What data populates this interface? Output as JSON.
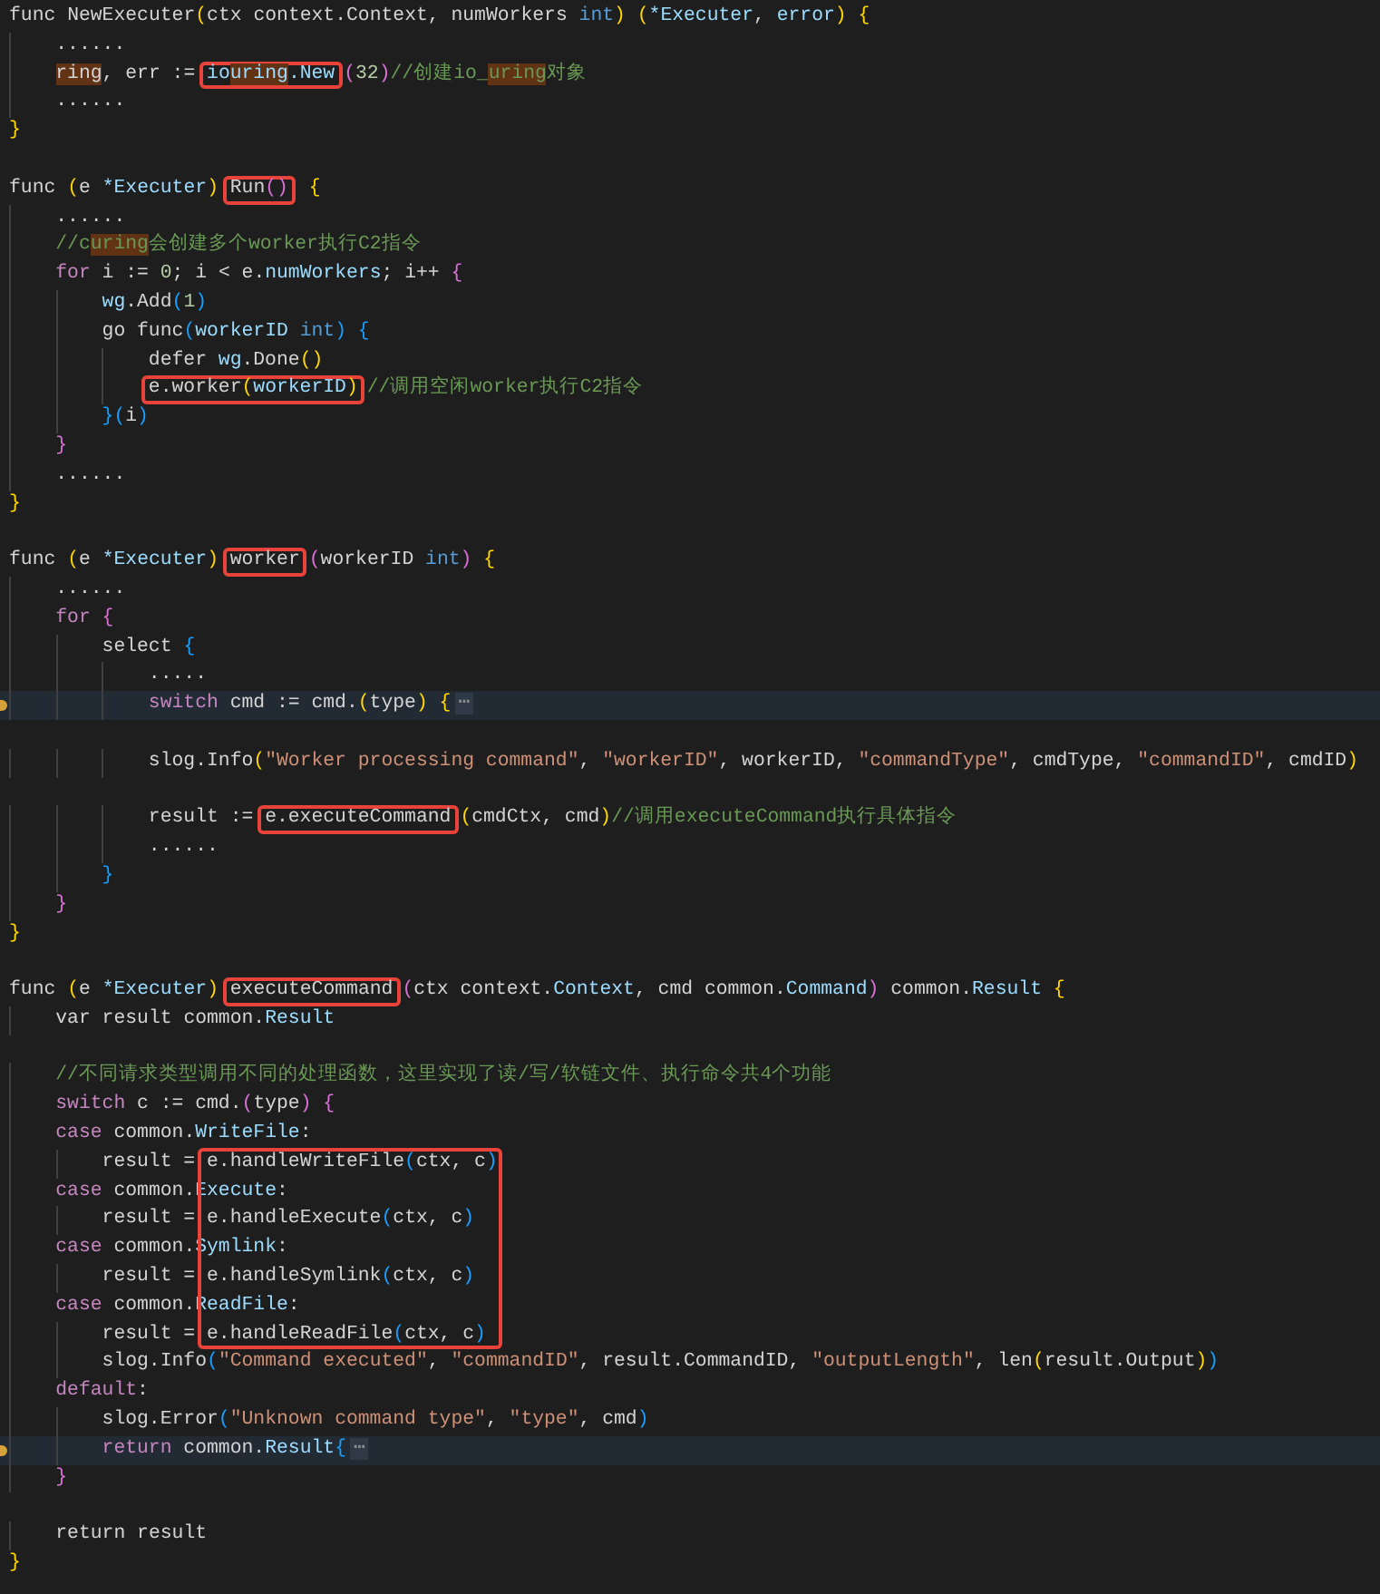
{
  "editor": {
    "lines": [
      {
        "kind": "code",
        "segments": [
          {
            "kind": "p",
            "text": "func NewExecuter"
          },
          {
            "kind": "b1",
            "text": "("
          },
          {
            "kind": "p",
            "text": "ctx context.Context, numWorkers "
          },
          {
            "kind": "k",
            "text": "int"
          },
          {
            "kind": "b1",
            "text": ") ("
          },
          {
            "kind": "i",
            "text": "*Executer"
          },
          {
            "kind": "p",
            "text": ", "
          },
          {
            "kind": "i",
            "text": "error"
          },
          {
            "kind": "b1",
            "text": ") {"
          }
        ]
      },
      {
        "kind": "code",
        "segments": [
          {
            "kind": "p",
            "text": "    ......"
          }
        ]
      },
      {
        "kind": "code",
        "segments": [
          {
            "kind": "p",
            "text": "    ring",
            "match": true
          },
          {
            "kind": "p",
            "text": ", err := "
          },
          {
            "kind": "i",
            "text": "io",
            "boxed": true
          },
          {
            "kind": "i",
            "text": "uring",
            "match": true,
            "boxed": true
          },
          {
            "kind": "i",
            "text": ".New",
            "boxed": true
          },
          {
            "kind": "b2",
            "text": "("
          },
          {
            "kind": "n",
            "text": "32"
          },
          {
            "kind": "b2",
            "text": ")"
          },
          {
            "kind": "m",
            "text": "//创建io_"
          },
          {
            "kind": "m",
            "text": "uring",
            "match": true
          },
          {
            "kind": "m",
            "text": "对象"
          }
        ]
      },
      {
        "kind": "code",
        "segments": [
          {
            "kind": "p",
            "text": "    ......"
          }
        ]
      },
      {
        "kind": "code",
        "segments": [
          {
            "kind": "b1",
            "text": "}"
          }
        ]
      },
      {
        "kind": "blank"
      },
      {
        "kind": "code",
        "segments": [
          {
            "kind": "p",
            "text": "func "
          },
          {
            "kind": "b1",
            "text": "("
          },
          {
            "kind": "p",
            "text": "e "
          },
          {
            "kind": "i",
            "text": "*Executer"
          },
          {
            "kind": "b1",
            "text": ") "
          },
          {
            "kind": "p",
            "text": "Run",
            "boxed": true
          },
          {
            "kind": "b2",
            "text": "()",
            "boxed": true
          },
          {
            "kind": "b1",
            "text": " {"
          }
        ]
      },
      {
        "kind": "code",
        "segments": [
          {
            "kind": "p",
            "text": "    ......"
          }
        ]
      },
      {
        "kind": "code",
        "segments": [
          {
            "kind": "m",
            "text": "    //c"
          },
          {
            "kind": "m",
            "text": "uring",
            "match": true
          },
          {
            "kind": "m",
            "text": "会创建多个worker执行C2指令"
          }
        ]
      },
      {
        "kind": "code",
        "segments": [
          {
            "kind": "c",
            "text": "    for"
          },
          {
            "kind": "p",
            "text": " i := "
          },
          {
            "kind": "n",
            "text": "0"
          },
          {
            "kind": "p",
            "text": "; i < e."
          },
          {
            "kind": "i",
            "text": "numWorkers"
          },
          {
            "kind": "p",
            "text": "; i++ "
          },
          {
            "kind": "b2",
            "text": "{"
          }
        ]
      },
      {
        "kind": "code",
        "segments": [
          {
            "kind": "i",
            "text": "        wg"
          },
          {
            "kind": "p",
            "text": ".Add"
          },
          {
            "kind": "b3",
            "text": "("
          },
          {
            "kind": "n",
            "text": "1"
          },
          {
            "kind": "b3",
            "text": ")"
          }
        ]
      },
      {
        "kind": "code",
        "segments": [
          {
            "kind": "p",
            "text": "        go func"
          },
          {
            "kind": "b3",
            "text": "("
          },
          {
            "kind": "i",
            "text": "workerID"
          },
          {
            "kind": "k",
            "text": " int"
          },
          {
            "kind": "b3",
            "text": ") {"
          }
        ]
      },
      {
        "kind": "code",
        "segments": [
          {
            "kind": "p",
            "text": "            defer "
          },
          {
            "kind": "i",
            "text": "wg"
          },
          {
            "kind": "p",
            "text": ".Done"
          },
          {
            "kind": "b1",
            "text": "()"
          }
        ]
      },
      {
        "kind": "code",
        "segments": [
          {
            "kind": "p",
            "text": "            e.worker",
            "boxed": true
          },
          {
            "kind": "b1",
            "text": "(",
            "boxed": true
          },
          {
            "kind": "i",
            "text": "workerID",
            "boxed": true
          },
          {
            "kind": "b1",
            "text": ")",
            "boxed": true
          },
          {
            "kind": "m",
            "text": "//调用空闲worker执行C2指令"
          }
        ]
      },
      {
        "kind": "code",
        "segments": [
          {
            "kind": "b3",
            "text": "        }("
          },
          {
            "kind": "p",
            "text": "i"
          },
          {
            "kind": "b3",
            "text": ")"
          }
        ]
      },
      {
        "kind": "code",
        "segments": [
          {
            "kind": "b2",
            "text": "    }"
          }
        ]
      },
      {
        "kind": "code",
        "segments": [
          {
            "kind": "p",
            "text": "    ......"
          }
        ]
      },
      {
        "kind": "code",
        "segments": [
          {
            "kind": "b1",
            "text": "}"
          }
        ]
      },
      {
        "kind": "blank"
      },
      {
        "kind": "code",
        "segments": [
          {
            "kind": "p",
            "text": "func "
          },
          {
            "kind": "b1",
            "text": "("
          },
          {
            "kind": "p",
            "text": "e "
          },
          {
            "kind": "i",
            "text": "*Executer"
          },
          {
            "kind": "b1",
            "text": ") "
          },
          {
            "kind": "p",
            "text": "worker",
            "boxed": true
          },
          {
            "kind": "b2",
            "text": "("
          },
          {
            "kind": "p",
            "text": "workerID "
          },
          {
            "kind": "k",
            "text": "int"
          },
          {
            "kind": "b2",
            "text": ") "
          },
          {
            "kind": "b1",
            "text": "{"
          }
        ]
      },
      {
        "kind": "code",
        "segments": [
          {
            "kind": "p",
            "text": "    ......"
          }
        ]
      },
      {
        "kind": "code",
        "segments": [
          {
            "kind": "c",
            "text": "    for"
          },
          {
            "kind": "b2",
            "text": " {"
          }
        ]
      },
      {
        "kind": "code",
        "segments": [
          {
            "kind": "p",
            "text": "        select "
          },
          {
            "kind": "b3",
            "text": "{"
          }
        ]
      },
      {
        "kind": "code",
        "segments": [
          {
            "kind": "p",
            "text": "            ....."
          }
        ]
      },
      {
        "kind": "code",
        "folded": true,
        "segments": [
          {
            "kind": "c",
            "text": "            switch"
          },
          {
            "kind": "p",
            "text": " cmd := cmd."
          },
          {
            "kind": "b1",
            "text": "("
          },
          {
            "kind": "p",
            "text": "type"
          },
          {
            "kind": "b1",
            "text": ") {"
          },
          {
            "kind": "f",
            "text": "⋯"
          }
        ]
      },
      {
        "kind": "blank"
      },
      {
        "kind": "code",
        "segments": [
          {
            "kind": "p",
            "text": "            slog.Info"
          },
          {
            "kind": "b1",
            "text": "("
          },
          {
            "kind": "s",
            "text": "\"Worker processing command\""
          },
          {
            "kind": "p",
            "text": ", "
          },
          {
            "kind": "s",
            "text": "\"workerID\""
          },
          {
            "kind": "p",
            "text": ", workerID, "
          },
          {
            "kind": "s",
            "text": "\"commandType\""
          },
          {
            "kind": "p",
            "text": ", cmdType, "
          },
          {
            "kind": "s",
            "text": "\"commandID\""
          },
          {
            "kind": "p",
            "text": ", cmdID"
          },
          {
            "kind": "b1",
            "text": ")"
          }
        ]
      },
      {
        "kind": "blank"
      },
      {
        "kind": "code",
        "segments": [
          {
            "kind": "p",
            "text": "            result := "
          },
          {
            "kind": "p",
            "text": "e.executeCommand",
            "boxed": true
          },
          {
            "kind": "b1",
            "text": "("
          },
          {
            "kind": "p",
            "text": "cmdCtx, cmd"
          },
          {
            "kind": "b1",
            "text": ")"
          },
          {
            "kind": "m",
            "text": "//调用executeCommand执行具体指令"
          }
        ]
      },
      {
        "kind": "code",
        "segments": [
          {
            "kind": "p",
            "text": "            ......"
          }
        ]
      },
      {
        "kind": "code",
        "segments": [
          {
            "kind": "b3",
            "text": "        }"
          }
        ]
      },
      {
        "kind": "code",
        "segments": [
          {
            "kind": "b2",
            "text": "    }"
          }
        ]
      },
      {
        "kind": "code",
        "segments": [
          {
            "kind": "b1",
            "text": "}"
          }
        ]
      },
      {
        "kind": "blank"
      },
      {
        "kind": "code",
        "segments": [
          {
            "kind": "p",
            "text": "func "
          },
          {
            "kind": "b1",
            "text": "("
          },
          {
            "kind": "p",
            "text": "e "
          },
          {
            "kind": "i",
            "text": "*Executer"
          },
          {
            "kind": "b1",
            "text": ") "
          },
          {
            "kind": "p",
            "text": "executeCommand",
            "boxed": true
          },
          {
            "kind": "b2",
            "text": "("
          },
          {
            "kind": "p",
            "text": "ctx context."
          },
          {
            "kind": "i",
            "text": "Context"
          },
          {
            "kind": "p",
            "text": ", cmd common."
          },
          {
            "kind": "i",
            "text": "Command"
          },
          {
            "kind": "b2",
            "text": ")"
          },
          {
            "kind": "p",
            "text": " common."
          },
          {
            "kind": "i",
            "text": "Result"
          },
          {
            "kind": "b1",
            "text": " {"
          }
        ]
      },
      {
        "kind": "code",
        "segments": [
          {
            "kind": "p",
            "text": "    var result common."
          },
          {
            "kind": "i",
            "text": "Result"
          }
        ]
      },
      {
        "kind": "blank"
      },
      {
        "kind": "code",
        "segments": [
          {
            "kind": "m",
            "text": "    //不同请求类型调用不同的处理函数，这里实现了读/写/软链文件、执行命令共4个功能"
          }
        ]
      },
      {
        "kind": "code",
        "segments": [
          {
            "kind": "c",
            "text": "    switch"
          },
          {
            "kind": "p",
            "text": " c := cmd."
          },
          {
            "kind": "b2",
            "text": "("
          },
          {
            "kind": "p",
            "text": "type"
          },
          {
            "kind": "b2",
            "text": ") {"
          }
        ]
      },
      {
        "kind": "code",
        "segments": [
          {
            "kind": "c",
            "text": "    case"
          },
          {
            "kind": "p",
            "text": " common."
          },
          {
            "kind": "i",
            "text": "WriteFile"
          },
          {
            "kind": "p",
            "text": ":"
          }
        ]
      },
      {
        "kind": "code",
        "segments": [
          {
            "kind": "p",
            "text": "        result = "
          },
          {
            "kind": "p",
            "text": "e.handleWriteFile",
            "boxed": true
          },
          {
            "kind": "b3",
            "text": "(",
            "boxed": true
          },
          {
            "kind": "p",
            "text": "ctx, c",
            "boxed": true
          },
          {
            "kind": "b3",
            "text": ")",
            "boxed": true
          }
        ]
      },
      {
        "kind": "code",
        "segments": [
          {
            "kind": "c",
            "text": "    case"
          },
          {
            "kind": "p",
            "text": " common."
          },
          {
            "kind": "i",
            "text": "Execute"
          },
          {
            "kind": "p",
            "text": ":"
          }
        ]
      },
      {
        "kind": "code",
        "segments": [
          {
            "kind": "p",
            "text": "        result = "
          },
          {
            "kind": "p",
            "text": "e.handleExecute",
            "boxed": true
          },
          {
            "kind": "b3",
            "text": "(",
            "boxed": true
          },
          {
            "kind": "p",
            "text": "ctx, c",
            "boxed": true
          },
          {
            "kind": "b3",
            "text": ")",
            "boxed": true
          }
        ]
      },
      {
        "kind": "code",
        "segments": [
          {
            "kind": "c",
            "text": "    case"
          },
          {
            "kind": "p",
            "text": " common."
          },
          {
            "kind": "i",
            "text": "Symlink"
          },
          {
            "kind": "p",
            "text": ":"
          }
        ]
      },
      {
        "kind": "code",
        "segments": [
          {
            "kind": "p",
            "text": "        result = "
          },
          {
            "kind": "p",
            "text": "e.handleSymlink",
            "boxed": true
          },
          {
            "kind": "b3",
            "text": "(",
            "boxed": true
          },
          {
            "kind": "p",
            "text": "ctx, c",
            "boxed": true
          },
          {
            "kind": "b3",
            "text": ")",
            "boxed": true
          }
        ]
      },
      {
        "kind": "code",
        "segments": [
          {
            "kind": "c",
            "text": "    case"
          },
          {
            "kind": "p",
            "text": " common."
          },
          {
            "kind": "i",
            "text": "ReadFile"
          },
          {
            "kind": "p",
            "text": ":"
          }
        ]
      },
      {
        "kind": "code",
        "segments": [
          {
            "kind": "p",
            "text": "        result = "
          },
          {
            "kind": "p",
            "text": "e.handleReadFile",
            "boxed": true
          },
          {
            "kind": "b3",
            "text": "(",
            "boxed": true
          },
          {
            "kind": "p",
            "text": "ctx, c",
            "boxed": true
          },
          {
            "kind": "b3",
            "text": ")",
            "boxed": true
          }
        ]
      },
      {
        "kind": "code",
        "segments": [
          {
            "kind": "p",
            "text": "        slog.Info"
          },
          {
            "kind": "b3",
            "text": "("
          },
          {
            "kind": "s",
            "text": "\"Command executed\""
          },
          {
            "kind": "p",
            "text": ", "
          },
          {
            "kind": "s",
            "text": "\"commandID\""
          },
          {
            "kind": "p",
            "text": ", result.CommandID, "
          },
          {
            "kind": "s",
            "text": "\"outputLength\""
          },
          {
            "kind": "p",
            "text": ", len"
          },
          {
            "kind": "b1",
            "text": "("
          },
          {
            "kind": "p",
            "text": "result.Output"
          },
          {
            "kind": "b1",
            "text": ")"
          },
          {
            "kind": "b3",
            "text": ")"
          }
        ]
      },
      {
        "kind": "code",
        "segments": [
          {
            "kind": "c",
            "text": "    default"
          },
          {
            "kind": "p",
            "text": ":"
          }
        ]
      },
      {
        "kind": "code",
        "segments": [
          {
            "kind": "p",
            "text": "        slog.Error"
          },
          {
            "kind": "b3",
            "text": "("
          },
          {
            "kind": "s",
            "text": "\"Unknown command type\""
          },
          {
            "kind": "p",
            "text": ", "
          },
          {
            "kind": "s",
            "text": "\"type\""
          },
          {
            "kind": "p",
            "text": ", cmd"
          },
          {
            "kind": "b3",
            "text": ")"
          }
        ]
      },
      {
        "kind": "code",
        "folded": true,
        "segments": [
          {
            "kind": "c",
            "text": "        return"
          },
          {
            "kind": "p",
            "text": " common."
          },
          {
            "kind": "i",
            "text": "Result"
          },
          {
            "kind": "b3",
            "text": "{"
          },
          {
            "kind": "f",
            "text": "⋯"
          }
        ]
      },
      {
        "kind": "code",
        "segments": [
          {
            "kind": "b2",
            "text": "    }"
          }
        ]
      },
      {
        "kind": "blank"
      },
      {
        "kind": "code",
        "segments": [
          {
            "kind": "p",
            "text": "    return result"
          }
        ]
      },
      {
        "kind": "code",
        "segments": [
          {
            "kind": "b1",
            "text": "}"
          }
        ]
      }
    ]
  }
}
